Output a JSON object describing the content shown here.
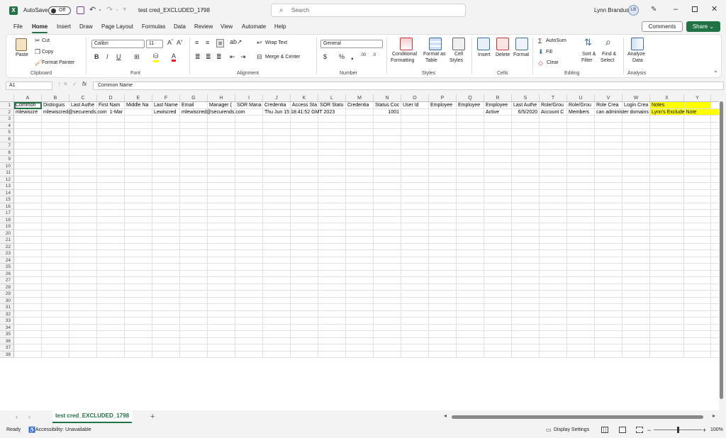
{
  "titlebar": {
    "autosave_label": "AutoSave",
    "autosave_state": "Off",
    "filename": "test cred_EXCLUDED_1798",
    "search_placeholder": "Search",
    "user_name": "Lynn Brandus",
    "user_initials": "LB"
  },
  "menu": {
    "tabs": [
      "File",
      "Home",
      "Insert",
      "Draw",
      "Page Layout",
      "Formulas",
      "Data",
      "Review",
      "View",
      "Automate",
      "Help"
    ],
    "active": "Home",
    "comments_label": "Comments",
    "share_label": "Share"
  },
  "ribbon": {
    "clipboard": {
      "label": "Clipboard",
      "paste": "Paste",
      "cut": "Cut",
      "copy": "Copy",
      "format_painter": "Format Painter"
    },
    "font": {
      "label": "Font",
      "font_name": "Calibri",
      "font_size": "11"
    },
    "alignment": {
      "label": "Alignment",
      "wrap_text": "Wrap Text",
      "merge_center": "Merge & Center"
    },
    "number": {
      "label": "Number",
      "format": "General"
    },
    "styles": {
      "label": "Styles",
      "conditional": "Conditional",
      "formatting": "Formatting",
      "format_as": "Format as",
      "table": "Table",
      "cell": "Cell",
      "cell_styles": "Styles"
    },
    "cells": {
      "label": "Cells",
      "insert": "Insert",
      "delete": "Delete",
      "format": "Format"
    },
    "editing": {
      "label": "Editing",
      "autosum": "AutoSum",
      "fill": "Fill",
      "clear": "Clear",
      "sort": "Sort &",
      "filter": "Filter",
      "find": "Find &",
      "select": "Select"
    },
    "analysis": {
      "label": "Analysis",
      "analyze": "Analyze",
      "data": "Data"
    }
  },
  "formula_bar": {
    "name_box": "A1",
    "fx": "fx",
    "content": "Common Name"
  },
  "grid": {
    "columns": [
      "A",
      "B",
      "C",
      "D",
      "E",
      "F",
      "G",
      "H",
      "I",
      "J",
      "K",
      "L",
      "M",
      "N",
      "O",
      "P",
      "Q",
      "R",
      "S",
      "T",
      "U",
      "V",
      "W",
      "X",
      "Y"
    ],
    "row_count": 38,
    "row1": [
      "Common",
      "Distinguis",
      "Last Authe",
      "First Nam",
      "Middle Na",
      "Last Name",
      "Email",
      "Manager (",
      "SOR Mana",
      "Credentia",
      "Access Sta",
      "SOR Statu",
      "Credentia",
      "Status Coc",
      "User Id",
      "Employee",
      "Employee",
      "Employee",
      "Last Authe",
      "Role/Grou",
      "Role/Grou",
      "Role Crea",
      "Login Crea",
      "Notes",
      ""
    ],
    "row2": [
      "mlewiscre",
      "mlewiscred@securends.com",
      "",
      "1-Mar",
      "",
      "Lewiscred",
      "mlewiscred@securends.com",
      "",
      "",
      "Thu Jun 15 18:41:52 GMT 2023",
      "",
      "",
      "",
      "1001",
      "",
      "",
      "",
      "Active",
      "6/5/2020",
      "Account C",
      "Members",
      "can administer domains",
      "",
      "Lynn's Exclude Note",
      ""
    ]
  },
  "sheet": {
    "tab_name": "test cred_EXCLUDED_1798",
    "add_label": "+"
  },
  "status": {
    "ready": "Ready",
    "accessibility": "Accessibility: Unavailable",
    "display_settings": "Display Settings",
    "zoom": "100%"
  }
}
